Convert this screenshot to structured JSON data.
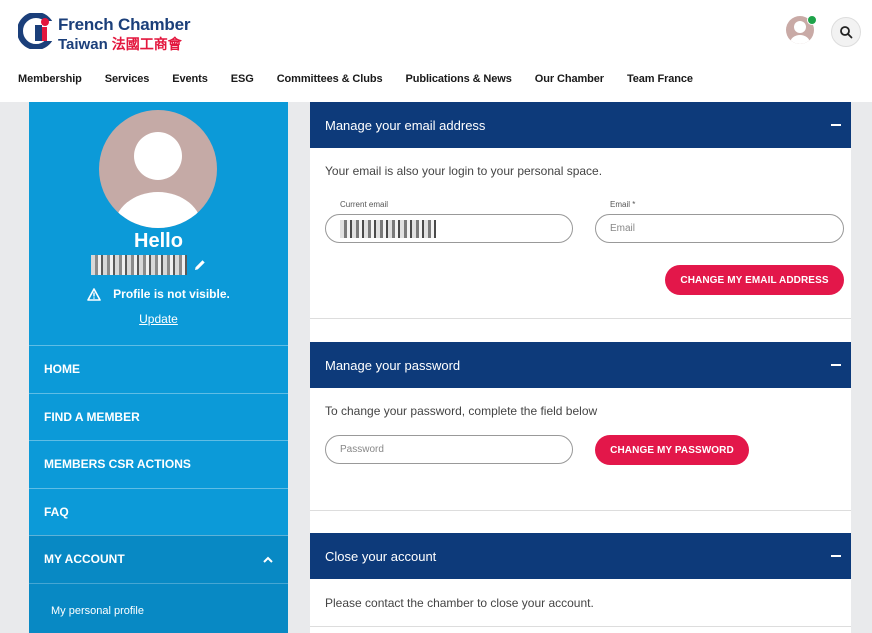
{
  "brand": {
    "line1": "French Chamber",
    "line2": "Taiwan",
    "line2_cn": "法國工商會",
    "primary_color": "#1b3f7a",
    "accent_color": "#e3173e"
  },
  "nav": {
    "items": [
      "Membership",
      "Services",
      "Events",
      "ESG",
      "Committees & Clubs",
      "Publications & News",
      "Our Chamber",
      "Team France"
    ]
  },
  "sidebar": {
    "hello": "Hello",
    "visibility_text": "Profile is not visible.",
    "update_label": "Update",
    "menu": [
      {
        "label": "HOME"
      },
      {
        "label": "FIND A MEMBER"
      },
      {
        "label": "MEMBERS CSR ACTIONS"
      },
      {
        "label": "FAQ"
      },
      {
        "label": "MY ACCOUNT"
      }
    ],
    "submenu": [
      {
        "label": "My personal profile"
      }
    ],
    "color": "#0c9ad8"
  },
  "email_section": {
    "title": "Manage your email address",
    "description": "Your email is also your login to your personal space.",
    "current_label": "Current email",
    "email_label": "Email *",
    "email_placeholder": "Email",
    "button_label": "CHANGE MY EMAIL ADDRESS"
  },
  "password_section": {
    "title": "Manage your password",
    "description": "To change your password, complete the field below",
    "password_placeholder": "Password",
    "button_label": "CHANGE MY PASSWORD"
  },
  "close_section": {
    "title": "Close your account",
    "description": "Please contact the chamber to close your account."
  },
  "icons": {
    "search": "search-icon",
    "edit": "pencil-icon",
    "warning": "warning-icon",
    "collapse": "minus-icon",
    "chevron": "chevron-up-icon"
  }
}
